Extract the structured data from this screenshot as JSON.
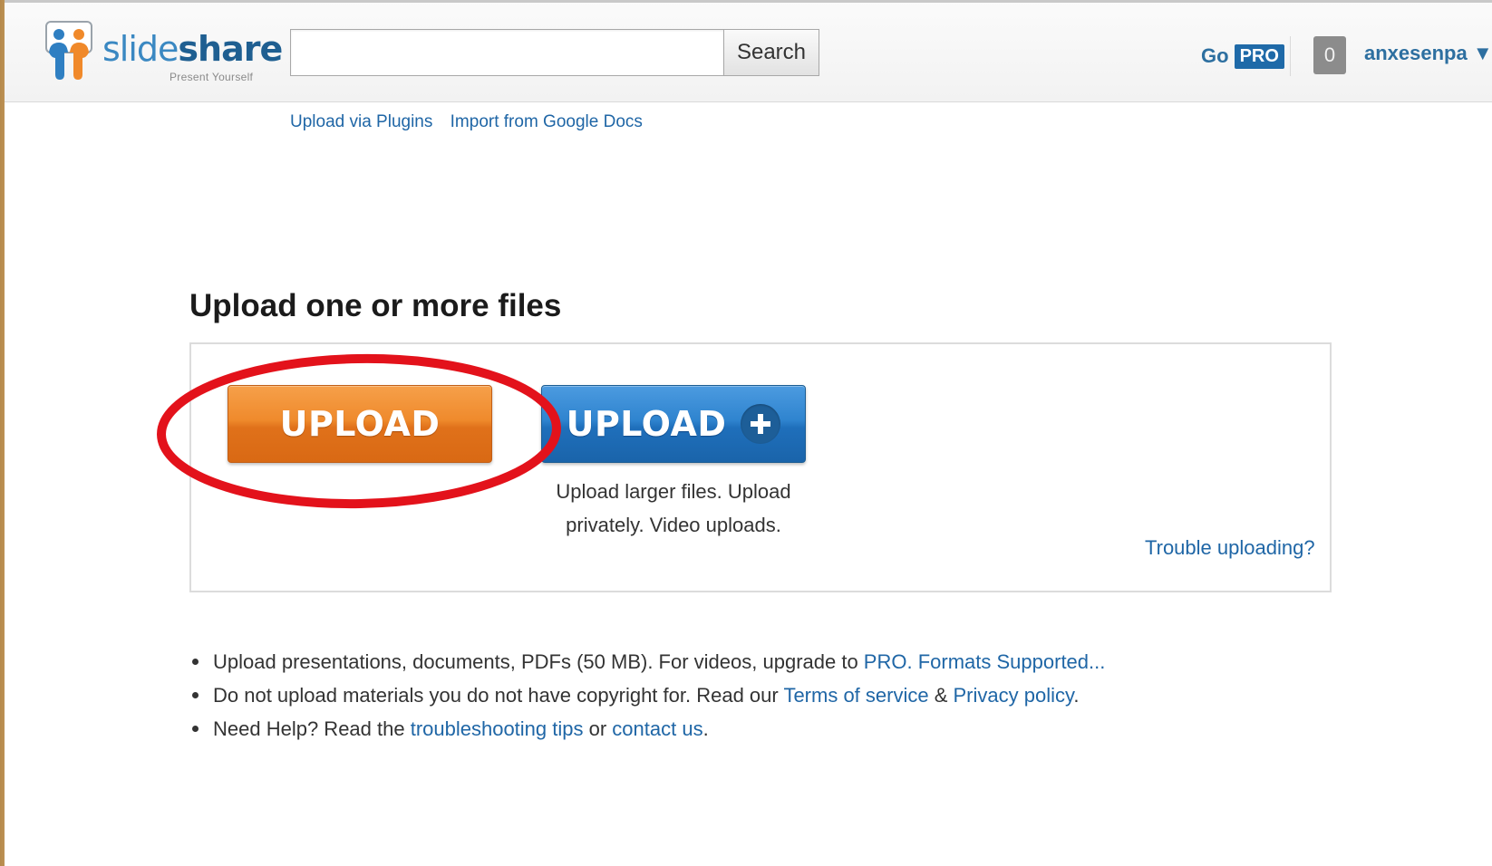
{
  "header": {
    "logo": {
      "word_light": "slide",
      "word_strong": "share",
      "tagline": "Present Yourself"
    },
    "search": {
      "value": "",
      "placeholder": "",
      "button_label": "Search"
    },
    "go_pro": {
      "go_label": "Go",
      "pro_label": "PRO"
    },
    "notification_count": "0",
    "username": "anxesenpa ▼"
  },
  "sub_links": {
    "upload_via_plugins": "Upload via Plugins",
    "import_google_docs": "Import from Google Docs"
  },
  "upload": {
    "title": "Upload one or more files",
    "upload_button_label": "UPLOAD",
    "upload_plus_button_label": "UPLOAD",
    "upload_plus_desc_line1": "Upload larger files. Upload",
    "upload_plus_desc_line2": "privately. Video uploads.",
    "trouble_link": "Trouble uploading?"
  },
  "notes": {
    "line1": {
      "text_before": "Upload presentations, documents, PDFs (50 MB). For videos, upgrade to ",
      "link_pro": "PRO.",
      "space": " ",
      "link_formats": "Formats Supported..."
    },
    "line2": {
      "text_before": "Do not upload materials you do not have copyright for. Read our ",
      "link_terms": "Terms of service",
      "text_mid": " & ",
      "link_privacy": "Privacy policy",
      "text_after": "."
    },
    "line3": {
      "text_before": "Need Help? Read the ",
      "link_tips": "troubleshooting tips",
      "text_mid": " or ",
      "link_contact": "contact us",
      "text_after": "."
    }
  },
  "colors": {
    "link_blue": "#1f66a6",
    "upload_orange": "#ef8a2c",
    "upload_plus_blue": "#2f84cf",
    "annotation_red": "#e3121b",
    "pro_badge": "#1f6aa8"
  },
  "icons": {
    "logo_mark": "slideshare-people-logo-icon",
    "plus": "plus-circle-icon",
    "dropdown": "caret-down-icon"
  }
}
